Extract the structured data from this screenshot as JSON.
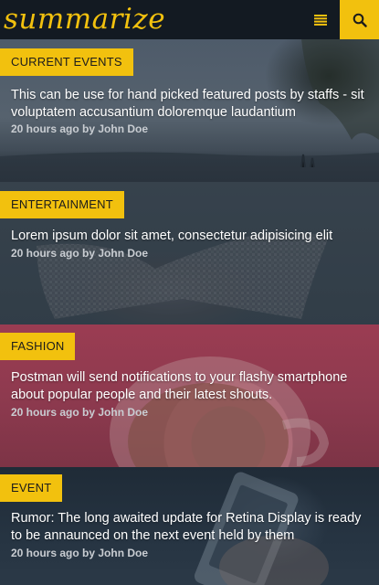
{
  "header": {
    "logo": "summarize",
    "menu_icon": "menu-icon",
    "search_icon": "search-icon",
    "accent_color": "#f2c10e"
  },
  "posts": [
    {
      "category": "CURRENT EVENTS",
      "title": "This can be use for hand picked featured posts by staffs - sit voluptatem accusantium doloremque laudantium",
      "meta": "20 hours ago by John Doe"
    },
    {
      "category": "ENTERTAINMENT",
      "title": "Lorem ipsum dolor sit amet, consectetur adipisicing elit",
      "meta": "20 hours ago by John Doe"
    },
    {
      "category": "FASHION",
      "title": "Postman will send notifications to your flashy smartphone about popular people and their latest shouts.",
      "meta": "20 hours ago by John Doe"
    },
    {
      "category": "EVENT",
      "title": "Rumor: The long awaited update for Retina Display is ready to be annaunced on the next event held by them",
      "meta": "20 hours ago by John Doe"
    }
  ]
}
